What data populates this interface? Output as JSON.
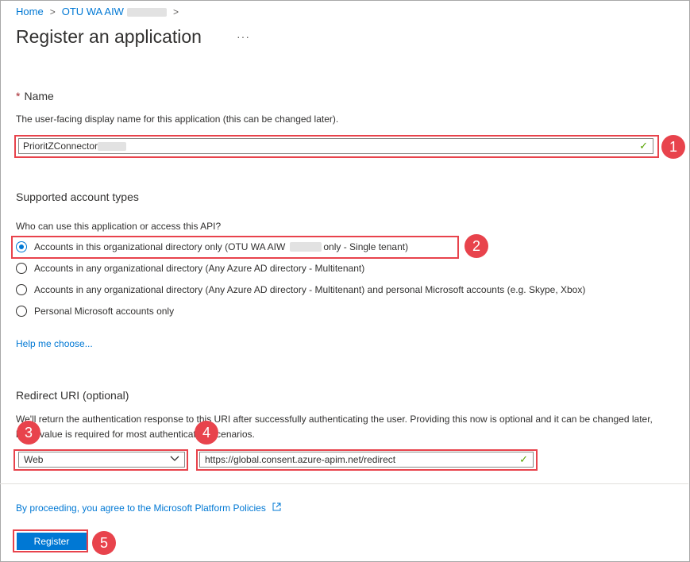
{
  "breadcrumb": {
    "home": "Home",
    "tenant": "OTU WA AIW",
    "separator": ">"
  },
  "page": {
    "title": "Register an application",
    "more": "···"
  },
  "name_section": {
    "label": "Name",
    "required_mark": "*",
    "description": "The user-facing display name for this application (this can be changed later).",
    "value": "PrioritZConnector",
    "valid_icon": "✓"
  },
  "account_types": {
    "heading": "Supported account types",
    "question": "Who can use this application or access this API?",
    "options": [
      {
        "label_a": "Accounts in this organizational directory only (OTU WA AIW",
        "label_b": "only - Single tenant)",
        "selected": true
      },
      {
        "label": "Accounts in any organizational directory (Any Azure AD directory - Multitenant)",
        "selected": false
      },
      {
        "label": "Accounts in any organizational directory (Any Azure AD directory - Multitenant) and personal Microsoft accounts (e.g. Skype, Xbox)",
        "selected": false
      },
      {
        "label": "Personal Microsoft accounts only",
        "selected": false
      }
    ],
    "help_link": "Help me choose..."
  },
  "redirect": {
    "heading": "Redirect URI (optional)",
    "description": "We'll return the authentication response to this URI after successfully authenticating the user. Providing this now is optional and it can be changed later, but a value is required for most authentication scenarios.",
    "platform": "Web",
    "uri": "https://global.consent.azure-apim.net/redirect",
    "valid_icon": "✓"
  },
  "footer": {
    "policy_link": "By proceeding, you agree to the Microsoft Platform Policies",
    "register_label": "Register"
  },
  "callouts": [
    "1",
    "2",
    "3",
    "4",
    "5"
  ],
  "colors": {
    "accent": "#0078d4",
    "callout": "#e8434c",
    "valid": "#57a300"
  },
  "icons": {
    "external_link": "external-link-icon",
    "chevron": "chevron-down-icon",
    "ellipsis": "ellipsis-icon"
  }
}
